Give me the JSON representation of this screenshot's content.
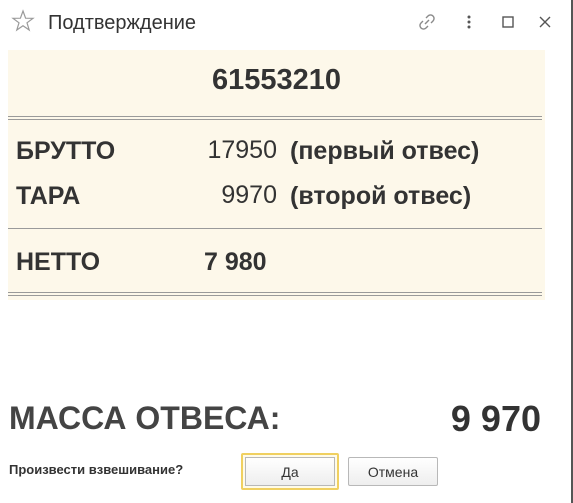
{
  "window": {
    "title": "Подтверждение"
  },
  "panel": {
    "code": "61553210",
    "rows": [
      {
        "label": "БРУТТО",
        "value": "17950",
        "note": "(первый отвес)"
      },
      {
        "label": "ТАРА",
        "value": "9970",
        "note": "(второй отвес)"
      }
    ],
    "net": {
      "label": "НЕТТО",
      "value": "7 980"
    }
  },
  "mass": {
    "label": "МАССА ОТВЕСА:",
    "value": "9 970"
  },
  "prompt": {
    "question": "Произвести взвешивание?",
    "yes_label": "Да",
    "cancel_label": "Отмена"
  },
  "icons": {
    "star": "star-icon",
    "link": "link-icon",
    "more": "more-icon",
    "maximize": "maximize-icon",
    "close": "close-icon"
  },
  "colors": {
    "panel_bg": "#fdf8ea",
    "default_button_border": "#f0d060",
    "text": "#333333"
  }
}
